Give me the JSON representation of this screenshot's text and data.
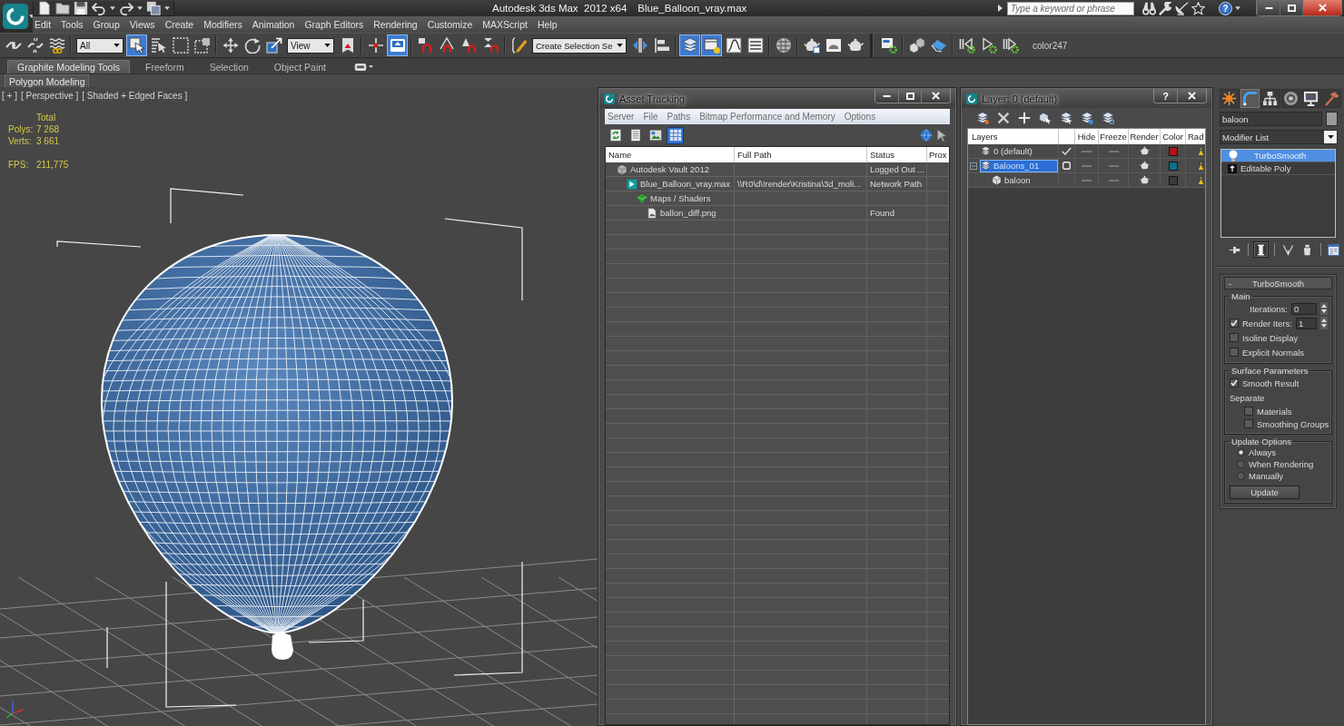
{
  "title_bar": {
    "app_title": "Autodesk 3ds Max  2012 x64",
    "file_name": "Blue_Balloon_vray.max",
    "search": {
      "placeholder": "Type a keyword or phrase"
    },
    "help": "?"
  },
  "menu": [
    "Edit",
    "Tools",
    "Group",
    "Views",
    "Create",
    "Modifiers",
    "Animation",
    "Graph Editors",
    "Rendering",
    "Customize",
    "MAXScript",
    "Help"
  ],
  "toolbar": [
    [
      {
        "kind": "button",
        "on": false
      },
      {
        "kind": "button",
        "on": false
      },
      {
        "kind": "button",
        "on": false
      }
    ],
    [
      {
        "kind": "dropdown",
        "value": "All"
      },
      {
        "kind": "button",
        "on": true
      },
      {
        "kind": "button",
        "on": false
      },
      {
        "kind": "button",
        "on": false
      },
      {
        "kind": "button",
        "on": false
      }
    ],
    [
      {
        "kind": "button",
        "on": false
      },
      {
        "kind": "button",
        "on": false
      },
      {
        "kind": "button",
        "on": false
      },
      {
        "kind": "dropdown",
        "value": "View"
      },
      {
        "kind": "button",
        "on": false
      }
    ],
    [
      {
        "kind": "button",
        "on": false
      },
      {
        "kind": "button",
        "on": true
      }
    ],
    [
      {
        "kind": "button",
        "on": false
      },
      {
        "kind": "button",
        "on": false
      },
      {
        "kind": "button",
        "on": false
      },
      {
        "kind": "button",
        "on": false
      }
    ],
    [
      {
        "kind": "button",
        "on": false
      },
      {
        "kind": "dropdown",
        "value": "Create Selection Se"
      },
      {
        "kind": "button",
        "on": false
      },
      {
        "kind": "button",
        "on": false
      }
    ],
    [
      {
        "kind": "button",
        "on": true
      },
      {
        "kind": "button",
        "on": true
      },
      {
        "kind": "button",
        "on": false
      },
      {
        "kind": "button",
        "on": false
      }
    ],
    [
      {
        "kind": "button",
        "on": false
      }
    ],
    [
      {
        "kind": "button",
        "on": false
      },
      {
        "kind": "button",
        "on": false
      },
      {
        "kind": "button",
        "on": false
      }
    ],
    [
      {
        "kind": "button",
        "on": false
      }
    ],
    [
      {
        "kind": "button",
        "on": false
      },
      {
        "kind": "button",
        "on": false
      }
    ],
    [
      {
        "kind": "button",
        "on": false
      },
      {
        "kind": "button",
        "on": false
      },
      {
        "kind": "button",
        "on": false
      },
      {
        "kind": "label",
        "text": "color247"
      }
    ]
  ],
  "ribbon": {
    "tabs": [
      {
        "label": "Graphite Modeling Tools",
        "selected": true
      },
      {
        "label": "Freeform",
        "selected": false
      },
      {
        "label": "Selection",
        "selected": false
      },
      {
        "label": "Object Paint",
        "selected": false
      }
    ],
    "panels": [
      {
        "label": "Polygon Modeling",
        "selected": true
      }
    ]
  },
  "viewport": {
    "labels": [
      "[ + ]",
      "[ Perspective ]",
      "[ Shaded + Edged Faces ]"
    ],
    "stats": {
      "heading": "Total",
      "rows": [
        {
          "label": "Polys:",
          "value": "7 268"
        },
        {
          "label": "Verts:",
          "value": "3 661"
        }
      ],
      "fps": {
        "label": "FPS:",
        "value": "211,775"
      }
    }
  },
  "asset_tracking": {
    "title": "Asset Tracking",
    "menu": [
      "Server",
      "File",
      "Paths",
      "Bitmap Performance and Memory",
      "Options"
    ],
    "toolbar": [
      {
        "on": false
      },
      {
        "on": false
      },
      {
        "on": false
      },
      {
        "on": true
      }
    ],
    "columns": [
      "Name",
      "Full Path",
      "Status",
      "Prox"
    ],
    "rows": [
      {
        "kind": "vault",
        "name": "Autodesk Vault 2012",
        "status": "Logged Out ...",
        "children": [
          {
            "kind": "scene",
            "name": "Blue_Balloon_vray.max",
            "path": "\\\\R0\\d\\!render\\Kristina\\3d_moli...",
            "status": "Network Path",
            "children": [
              {
                "kind": "folder",
                "name": "Maps / Shaders",
                "children": [
                  {
                    "kind": "bitmap",
                    "name": "ballon_diff.png",
                    "status": "Found"
                  }
                ]
              }
            ]
          }
        ]
      }
    ]
  },
  "layer_manager": {
    "title": "Layer: 0 (default)",
    "help": "?",
    "columns": [
      "Layers",
      "Hide",
      "Freeze",
      "Render",
      "Color",
      "Rad"
    ],
    "rows": [
      {
        "name": "0 (default)",
        "current": true,
        "selected": false,
        "hidden": false,
        "frozen": false,
        "renderable": true,
        "color": "#b01616"
      },
      {
        "name": "Baloons_01",
        "current": false,
        "selected": true,
        "expanded": true,
        "hidden": false,
        "frozen": false,
        "renderable": true,
        "color": "#0e7088",
        "children": [
          {
            "name": "baloon",
            "selected": false,
            "hidden": false,
            "frozen": false,
            "renderable": true,
            "color": "#3a3a3a"
          }
        ]
      }
    ]
  },
  "command_panel": {
    "tabs": [
      {
        "selected": false
      },
      {
        "selected": true
      },
      {
        "selected": false
      },
      {
        "selected": false
      },
      {
        "selected": false
      },
      {
        "selected": false
      }
    ],
    "object_name": "baloon",
    "modifier_list": "Modifier List",
    "stack": [
      {
        "kind": "modifier",
        "name": "TurboSmooth",
        "selected": true
      },
      {
        "kind": "base",
        "name": "Editable Poly",
        "selected": false
      }
    ],
    "stack_buttons": [
      {
        "on": false
      },
      {
        "on": true
      },
      {
        "on": false
      },
      {
        "on": false
      },
      {
        "on": false
      }
    ],
    "rollout": {
      "sign": "-",
      "title": "TurboSmooth",
      "groups": [
        {
          "title": "Main",
          "controls": [
            {
              "kind": "spinner",
              "label": "Iterations:",
              "value": "0"
            },
            {
              "kind": "spinner",
              "label": "Render Iters:",
              "value": "1",
              "checked": true
            },
            {
              "kind": "checkbox",
              "label": "Isoline Display",
              "checked": false
            },
            {
              "kind": "checkbox",
              "label": "Explicit Normals",
              "checked": false
            }
          ]
        },
        {
          "title": "Surface Parameters",
          "controls": [
            {
              "kind": "checkbox",
              "label": "Smooth Result",
              "checked": true
            },
            {
              "kind": "text",
              "label": "Separate",
              "children": [
                {
                  "kind": "checkbox",
                  "label": "Materials",
                  "checked": false
                },
                {
                  "kind": "checkbox",
                  "label": "Smoothing Groups",
                  "checked": false
                }
              ]
            }
          ]
        },
        {
          "title": "Update Options",
          "controls": [
            {
              "kind": "radio",
              "label": "Always",
              "selected": true
            },
            {
              "kind": "radio",
              "label": "When Rendering",
              "selected": false
            },
            {
              "kind": "radio",
              "label": "Manually",
              "selected": false
            },
            {
              "kind": "button",
              "label": "Update"
            }
          ]
        }
      ]
    }
  }
}
